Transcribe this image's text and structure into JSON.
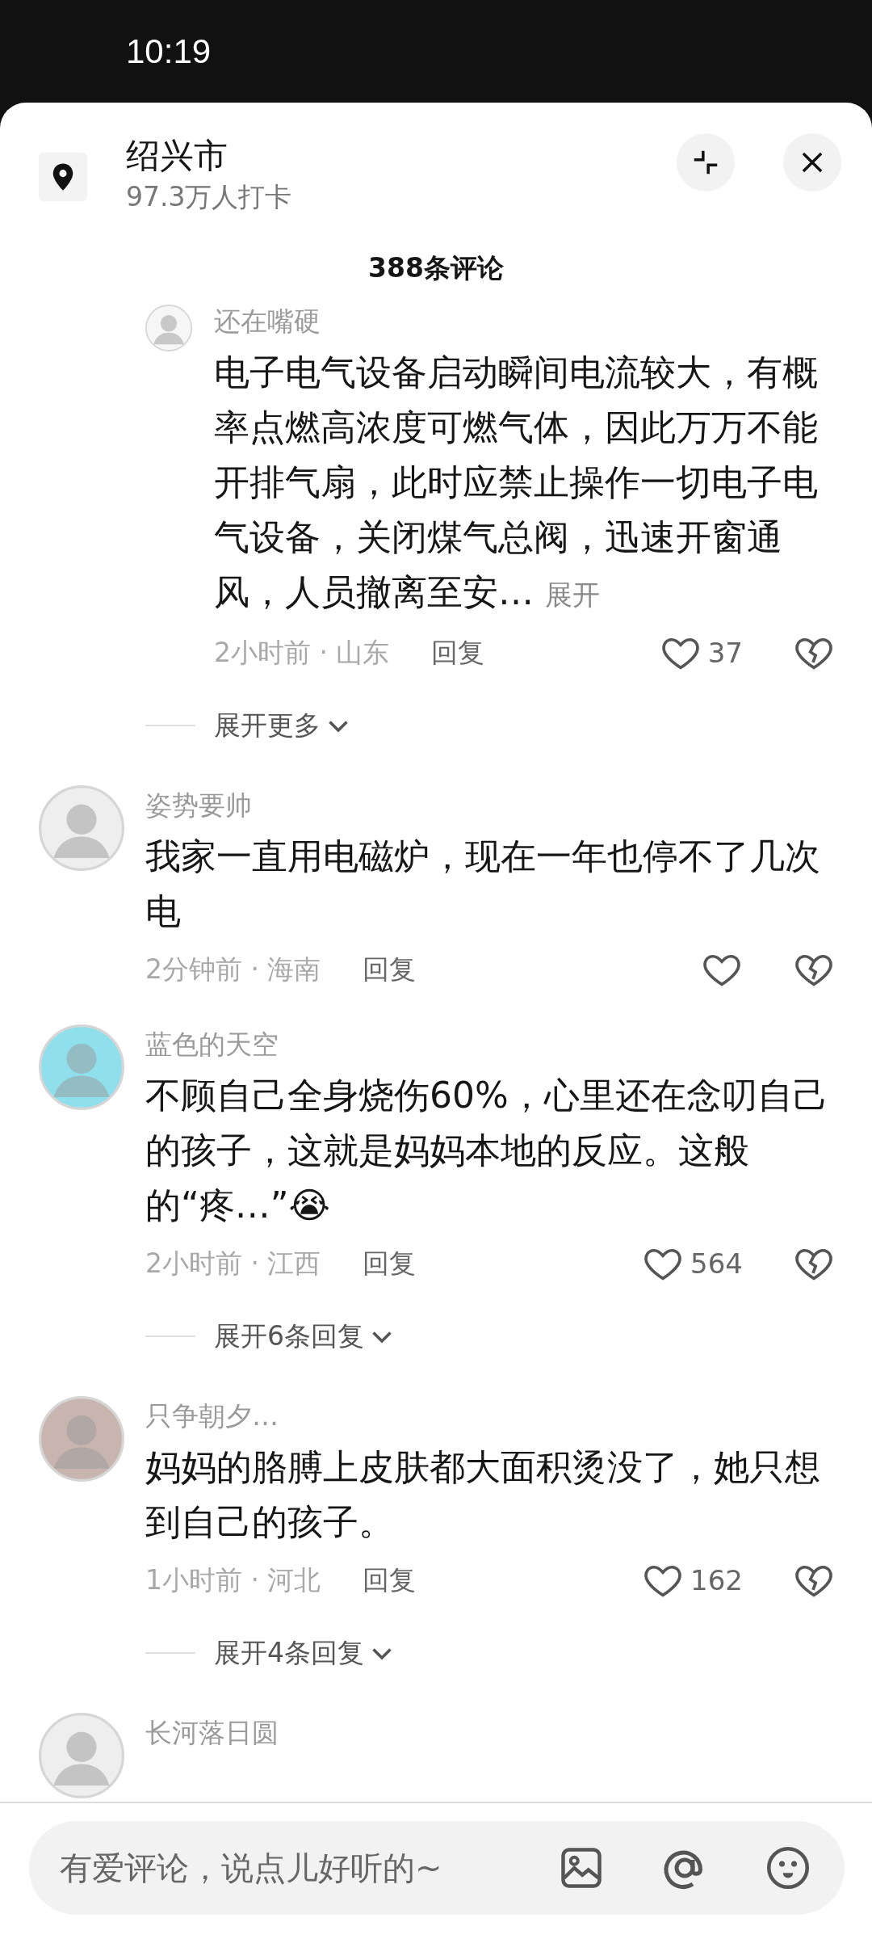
{
  "status_bar": {
    "time": "10:19"
  },
  "header": {
    "title": "绍兴市",
    "subtitle": "97.3万人打卡"
  },
  "comment_count": "388条评论",
  "comments": [
    {
      "kind": "reply",
      "color": "#f6f6f6",
      "name": "还在嘴硬",
      "text": "电子电气设备启动瞬间电流较大，有概率点燃高浓度可燃气体，因此万万不能开排气扇，此时应禁止操作一切电子电气设备，关闭煤气总阀，迅速开窗通风，人员撤离至安…",
      "more": "展开",
      "meta": "2小时前 · 山东",
      "reply": "回复",
      "likes": "37"
    },
    {
      "kind": "expander",
      "label": "展开更多"
    },
    {
      "kind": "comment",
      "color": "#eeeeee",
      "name": "姿势要帅",
      "text": "我家一直用电磁炉，现在一年也停不了几次电",
      "meta": "2分钟前 · 海南",
      "reply": "回复"
    },
    {
      "kind": "comment",
      "color": "#8fe0ec",
      "name": "蓝色的天空",
      "text": "不顾自己全身烧伤60%，心里还在念叨自己的孩子，这就是妈妈本地的反应。这般的“疼…”😭",
      "meta": "2小时前 · 江西",
      "reply": "回复",
      "likes": "564"
    },
    {
      "kind": "expander",
      "label": "展开6条回复"
    },
    {
      "kind": "comment",
      "color": "#c9b5b0",
      "name": "只争朝夕…",
      "text": "妈妈的胳膊上皮肤都大面积烫没了，她只想到自己的孩子。",
      "meta": "1小时前 · 河北",
      "reply": "回复",
      "likes": "162"
    },
    {
      "kind": "expander",
      "label": "展开4条回复"
    },
    {
      "kind": "comment",
      "color": "#eeeeee",
      "name": "长河落日圆"
    }
  ],
  "input": {
    "placeholder": "有爱评论，说点儿好听的~"
  }
}
